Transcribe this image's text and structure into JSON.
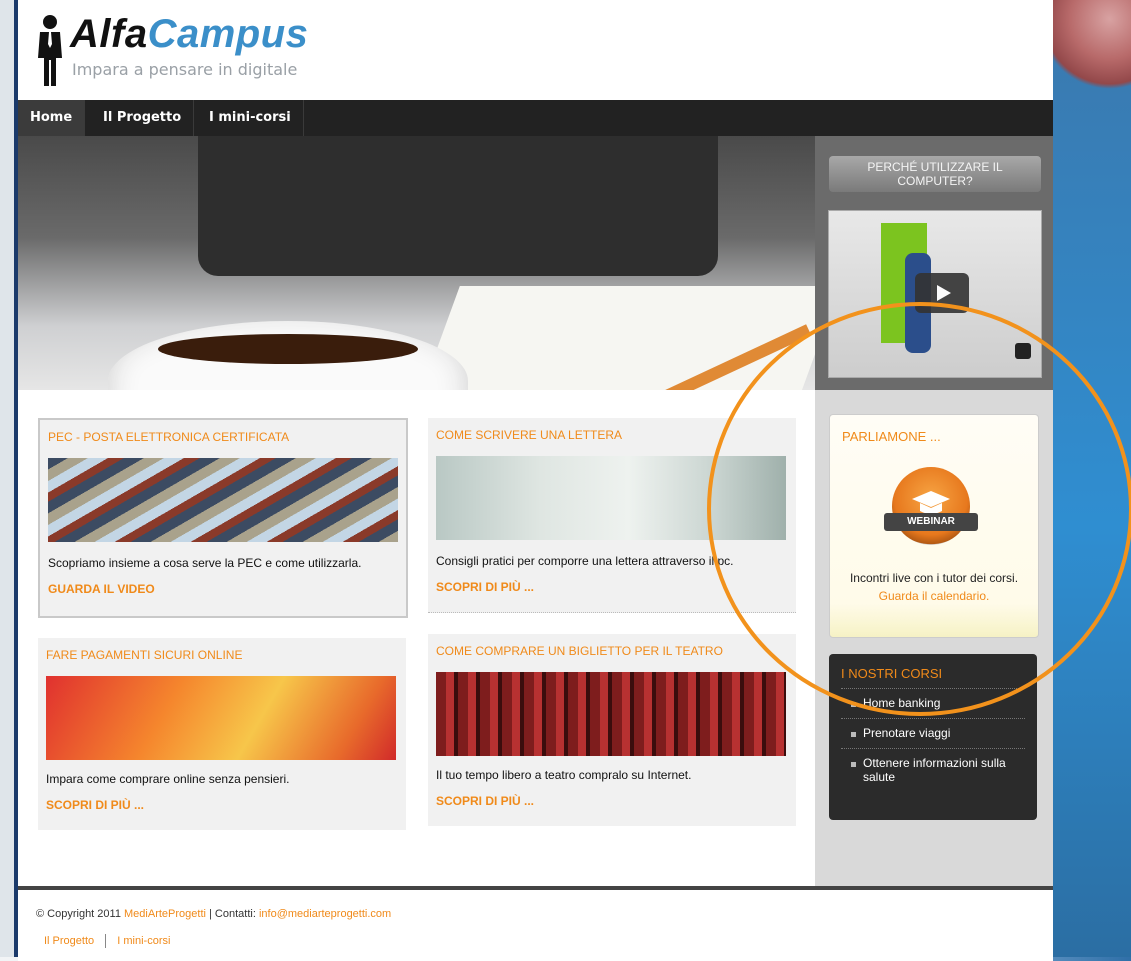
{
  "brand": {
    "name_part1": "Alfa",
    "name_part2": "Campus",
    "tagline": "Impara a pensare in digitale",
    "accent": "#f08a1a",
    "blue": "#3b8fc9"
  },
  "nav": {
    "items": [
      {
        "label": "Home",
        "active": true
      },
      {
        "label": "Il Progetto",
        "active": false
      },
      {
        "label": "I mini-corsi",
        "active": false
      }
    ]
  },
  "sidebar": {
    "why_button": "PERCHÉ UTILIZZARE IL COMPUTER?",
    "video": {
      "play_icon": "play-icon",
      "fullscreen_icon": "fullscreen-icon"
    },
    "webinar": {
      "title": "PARLIAMONE ...",
      "badge": "WEBINAR",
      "text": "Incontri live con i tutor dei corsi.",
      "link": "Guarda il calendario."
    },
    "courses": {
      "title": "I NOSTRI CORSI",
      "items": [
        "Home banking",
        "Prenotare viaggi",
        "Ottenere informazioni sulla salute"
      ]
    }
  },
  "articles": [
    {
      "title": "PEC - POSTA ELETTRONICA CERTIFICATA",
      "text": "Scopriamo insieme a cosa serve la PEC e come utilizzarla.",
      "link": "GUARDA IL VIDEO"
    },
    {
      "title": "COME SCRIVERE UNA LETTERA",
      "text": "Consigli pratici per comporre una lettera attraverso il pc.",
      "link": "SCOPRI DI PIÙ ..."
    },
    {
      "title": "FARE PAGAMENTI SICURI ONLINE",
      "text": "Impara come comprare online senza pensieri.",
      "link": "SCOPRI DI PIÙ ..."
    },
    {
      "title": "COME COMPRARE UN BIGLIETTO PER IL TEATRO",
      "text": "Il tuo tempo libero a teatro compralo su Internet.",
      "link": "SCOPRI DI PIÙ ..."
    }
  ],
  "footer": {
    "copyright": "© Copyright 2011",
    "company": "MediArteProgetti",
    "contacts_label": "| Contatti:",
    "email": "info@mediarteprogetti.com",
    "nav": [
      "Il Progetto",
      "I mini-corsi"
    ]
  }
}
